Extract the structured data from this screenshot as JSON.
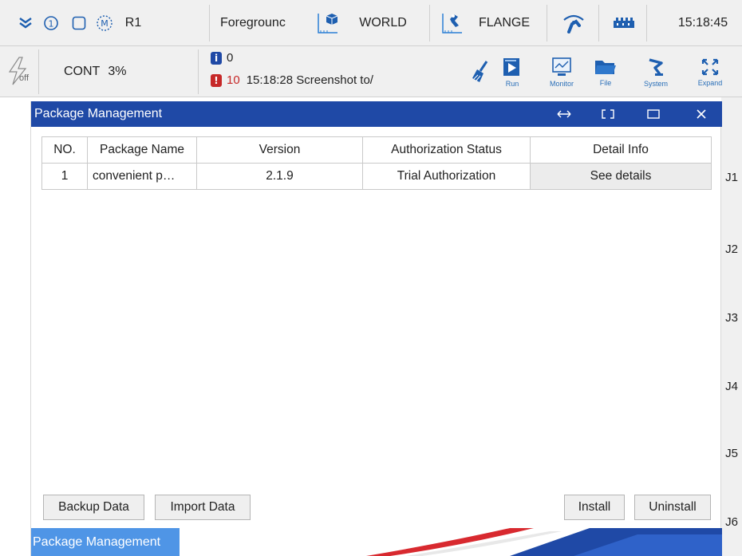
{
  "topbar": {
    "robot": "R1",
    "mode": "Foregrounc",
    "coord_frame": "WORLD",
    "tool_frame": "FLANGE",
    "clock": "15:18:45",
    "mode_glyph": "M"
  },
  "bar2": {
    "off_label": "off",
    "run_mode": "CONT",
    "speed": "3%",
    "info_count": "0",
    "error_count": "10",
    "last_message": "15:18:28 Screenshot to/",
    "tools": [
      {
        "label": "Run",
        "icon": "run-icon"
      },
      {
        "label": "Monitor",
        "icon": "monitor-icon"
      },
      {
        "label": "File",
        "icon": "folder-icon"
      },
      {
        "label": "System",
        "icon": "robot-arm-icon"
      },
      {
        "label": "Expand",
        "icon": "expand-icon"
      }
    ]
  },
  "dialog": {
    "title": "Package Management",
    "table": {
      "headers": [
        "NO.",
        "Package Name",
        "Version",
        "Authorization Status",
        "Detail Info"
      ],
      "rows": [
        {
          "no": "1",
          "name": "convenient p…",
          "version": "2.1.9",
          "auth": "Trial Authorization",
          "detail": "See details"
        }
      ]
    },
    "buttons": {
      "backup": "Backup Data",
      "import": "Import Data",
      "install": "Install",
      "uninstall": "Uninstall"
    },
    "bottom_tab": "Package Management"
  },
  "joints": [
    "J1",
    "J2",
    "J3",
    "J4",
    "J5",
    "J6"
  ],
  "colors": {
    "titlebar": "#1f49a6",
    "tab": "#4f95e6",
    "error": "#c62828",
    "info": "#1f49a6",
    "icon_blue": "#1e5fb0"
  }
}
